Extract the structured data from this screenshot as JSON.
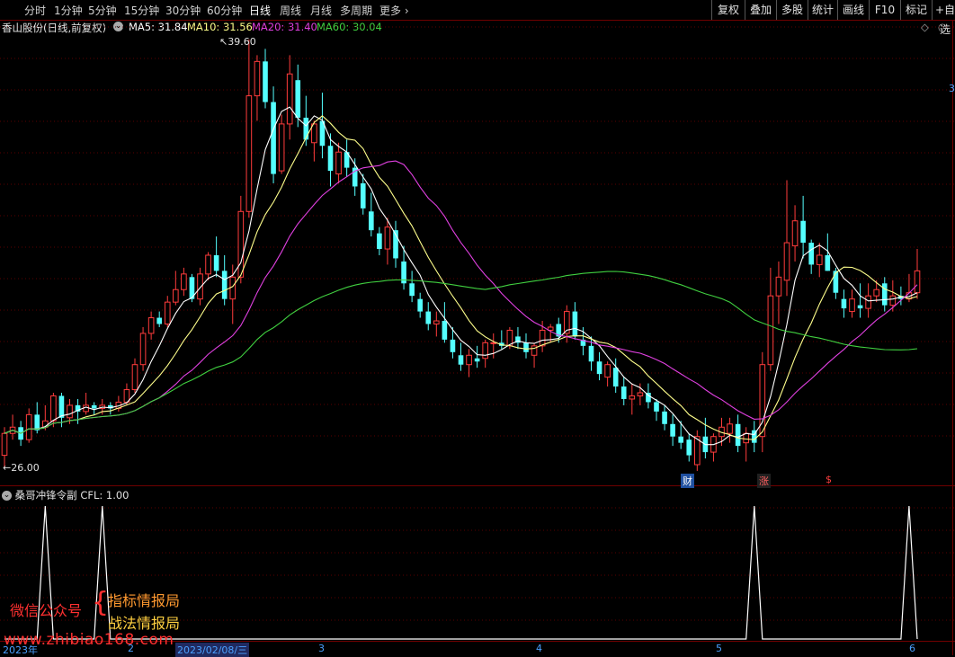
{
  "toolbar": {
    "periods": [
      "分时",
      "1分钟",
      "5分钟",
      "15分钟",
      "30分钟",
      "60分钟",
      "日线",
      "周线",
      "月线",
      "多周期",
      "更多 ›"
    ],
    "active_period": "日线",
    "right_buttons": [
      "复权",
      "叠加",
      "多股",
      "统计",
      "画线",
      "F10",
      "标记",
      "+自选"
    ]
  },
  "stock_info": {
    "title": "香山股份(日线,前复权)",
    "ma5": "MA5: 31.84",
    "ma10": "MA10: 31.56",
    "ma20": "MA20: 31.40",
    "ma60": "MA60: 30.04"
  },
  "colors": {
    "up": "#ff3c3c",
    "down": "#54ffff",
    "ma5": "#ffffff",
    "ma10": "#ffff8c",
    "ma20": "#e040e0",
    "ma60": "#40d040",
    "grid": "#5a0000",
    "axis_label": "#4aa0ff"
  },
  "price_markers": {
    "high_label": "39.60",
    "low_label": "26.00"
  },
  "right_edge_label": "3",
  "event_badges": [
    "财",
    "涨",
    "$"
  ],
  "indicator": {
    "title": "桑哥冲锋令副",
    "value": "CFL: 1.00"
  },
  "x_axis": {
    "year_label": "2023年",
    "date_cursor": "2023/02/08/三",
    "month_labels": [
      "2",
      "3",
      "4",
      "5",
      "6"
    ]
  },
  "watermark": {
    "left": "微信公众号",
    "line1": "指标情报局",
    "line2": "战法情报局",
    "url": "www.zhibiao168.com"
  },
  "chart_data": {
    "type": "candlestick",
    "ylim": [
      26.0,
      39.6
    ],
    "candles_ohlc": [
      [
        26.3,
        27.2,
        25.9,
        27.0
      ],
      [
        27.0,
        27.6,
        26.8,
        27.2
      ],
      [
        27.2,
        27.4,
        26.6,
        26.8
      ],
      [
        26.8,
        27.8,
        26.7,
        27.6
      ],
      [
        27.6,
        28.0,
        27.0,
        27.1
      ],
      [
        27.2,
        27.9,
        27.1,
        27.4
      ],
      [
        27.4,
        28.3,
        27.2,
        28.2
      ],
      [
        28.2,
        28.3,
        27.2,
        27.5
      ],
      [
        27.5,
        28.1,
        27.3,
        27.9
      ],
      [
        27.9,
        28.1,
        27.3,
        27.7
      ],
      [
        27.7,
        28.3,
        27.6,
        27.9
      ],
      [
        27.9,
        28.0,
        27.6,
        27.8
      ],
      [
        27.8,
        28.1,
        27.6,
        27.9
      ],
      [
        27.9,
        28.0,
        27.6,
        27.8
      ],
      [
        27.8,
        28.2,
        27.7,
        28.0
      ],
      [
        28.0,
        28.6,
        27.9,
        28.4
      ],
      [
        28.4,
        29.4,
        28.3,
        29.2
      ],
      [
        29.2,
        30.4,
        29.0,
        30.2
      ],
      [
        30.2,
        30.9,
        30.0,
        30.7
      ],
      [
        30.7,
        30.9,
        30.4,
        30.5
      ],
      [
        30.5,
        31.4,
        30.4,
        31.2
      ],
      [
        31.2,
        32.2,
        31.1,
        31.6
      ],
      [
        31.6,
        32.3,
        31.4,
        32.1
      ],
      [
        32.0,
        32.1,
        31.2,
        31.3
      ],
      [
        31.3,
        32.3,
        31.1,
        32.1
      ],
      [
        32.1,
        32.8,
        31.9,
        32.7
      ],
      [
        32.7,
        33.3,
        32.0,
        32.2
      ],
      [
        32.2,
        32.7,
        31.1,
        31.3
      ],
      [
        31.3,
        32.4,
        30.5,
        32.0
      ],
      [
        32.0,
        34.6,
        31.8,
        34.1
      ],
      [
        34.1,
        39.6,
        33.9,
        37.8
      ],
      [
        37.8,
        39.1,
        37.0,
        38.9
      ],
      [
        38.9,
        39.3,
        37.4,
        37.6
      ],
      [
        37.6,
        38.1,
        35.0,
        35.3
      ],
      [
        35.4,
        37.2,
        35.3,
        36.9
      ],
      [
        36.9,
        39.1,
        36.4,
        38.5
      ],
      [
        38.3,
        38.8,
        36.8,
        37.1
      ],
      [
        37.1,
        37.8,
        36.2,
        36.4
      ],
      [
        36.3,
        37.0,
        35.7,
        36.9
      ],
      [
        37.0,
        37.9,
        35.8,
        36.2
      ],
      [
        36.2,
        36.6,
        34.9,
        35.4
      ],
      [
        35.3,
        36.3,
        35.0,
        36.0
      ],
      [
        36.0,
        36.4,
        35.2,
        35.5
      ],
      [
        35.5,
        35.8,
        34.6,
        34.9
      ],
      [
        35.0,
        35.3,
        34.0,
        34.2
      ],
      [
        34.1,
        34.7,
        33.3,
        33.5
      ],
      [
        33.4,
        33.6,
        32.7,
        32.9
      ],
      [
        32.9,
        33.9,
        32.4,
        33.6
      ],
      [
        33.5,
        33.8,
        32.3,
        32.6
      ],
      [
        32.5,
        33.0,
        31.6,
        31.8
      ],
      [
        31.8,
        32.2,
        31.2,
        31.4
      ],
      [
        31.3,
        31.5,
        30.7,
        30.9
      ],
      [
        30.9,
        31.2,
        30.3,
        30.5
      ],
      [
        30.5,
        30.9,
        30.1,
        30.6
      ],
      [
        30.6,
        31.2,
        29.9,
        30.0
      ],
      [
        30.0,
        30.4,
        29.4,
        29.6
      ],
      [
        29.5,
        29.9,
        29.0,
        29.2
      ],
      [
        29.2,
        29.7,
        28.8,
        29.5
      ],
      [
        29.4,
        29.8,
        29.1,
        29.3
      ],
      [
        29.4,
        30.0,
        29.1,
        29.9
      ],
      [
        29.9,
        30.2,
        29.4,
        29.9
      ],
      [
        29.9,
        30.3,
        29.7,
        29.8
      ],
      [
        29.8,
        30.4,
        29.7,
        30.3
      ],
      [
        30.1,
        30.4,
        29.7,
        29.9
      ],
      [
        29.9,
        30.2,
        29.4,
        29.6
      ],
      [
        29.5,
        29.9,
        29.1,
        29.8
      ],
      [
        29.8,
        30.6,
        29.6,
        30.3
      ],
      [
        30.3,
        30.5,
        29.9,
        30.4
      ],
      [
        30.5,
        30.7,
        29.9,
        30.1
      ],
      [
        30.2,
        31.1,
        29.9,
        30.9
      ],
      [
        30.9,
        31.2,
        30.0,
        30.1
      ],
      [
        30.0,
        30.4,
        29.5,
        29.8
      ],
      [
        29.8,
        30.1,
        29.0,
        29.3
      ],
      [
        29.3,
        29.6,
        28.7,
        28.9
      ],
      [
        28.8,
        29.3,
        28.5,
        29.2
      ],
      [
        29.1,
        29.4,
        28.3,
        28.5
      ],
      [
        28.5,
        28.8,
        27.9,
        28.1
      ],
      [
        28.1,
        28.6,
        27.6,
        28.2
      ],
      [
        28.2,
        28.6,
        27.9,
        28.3
      ],
      [
        28.3,
        28.6,
        27.8,
        28.0
      ],
      [
        28.0,
        28.1,
        27.4,
        27.7
      ],
      [
        27.7,
        27.9,
        27.1,
        27.3
      ],
      [
        27.3,
        27.6,
        26.6,
        26.9
      ],
      [
        26.9,
        27.4,
        26.5,
        26.7
      ],
      [
        26.8,
        27.0,
        26.1,
        26.3
      ],
      [
        26.0,
        27.1,
        25.8,
        26.9
      ],
      [
        26.9,
        27.5,
        26.2,
        26.4
      ],
      [
        26.4,
        27.0,
        26.1,
        26.9
      ],
      [
        26.9,
        27.5,
        26.6,
        27.2
      ],
      [
        27.0,
        27.5,
        26.7,
        27.3
      ],
      [
        27.3,
        27.6,
        26.4,
        26.6
      ],
      [
        26.7,
        27.2,
        26.1,
        27.0
      ],
      [
        27.1,
        27.4,
        26.4,
        26.7
      ],
      [
        26.9,
        29.6,
        26.4,
        29.2
      ],
      [
        29.2,
        32.3,
        29.0,
        31.4
      ],
      [
        31.4,
        32.5,
        30.5,
        32.0
      ],
      [
        31.9,
        35.1,
        31.4,
        33.1
      ],
      [
        33.0,
        34.3,
        32.5,
        33.8
      ],
      [
        33.8,
        34.6,
        32.6,
        33.1
      ],
      [
        33.1,
        33.2,
        32.1,
        32.4
      ],
      [
        32.4,
        33.1,
        32.0,
        32.7
      ],
      [
        32.7,
        33.4,
        32.2,
        32.2
      ],
      [
        32.2,
        32.3,
        31.3,
        31.5
      ],
      [
        31.3,
        31.6,
        30.7,
        31.0
      ],
      [
        30.9,
        31.6,
        30.7,
        31.3
      ],
      [
        31.1,
        31.8,
        30.7,
        31.0
      ],
      [
        31.0,
        31.8,
        30.7,
        31.4
      ],
      [
        31.4,
        31.9,
        31.2,
        31.6
      ],
      [
        31.8,
        32.0,
        30.9,
        31.1
      ],
      [
        31.1,
        31.9,
        30.9,
        31.4
      ],
      [
        31.4,
        31.7,
        31.1,
        31.3
      ],
      [
        31.3,
        32.1,
        31.2,
        31.5
      ],
      [
        31.5,
        32.9,
        31.3,
        32.2
      ]
    ],
    "indicator_signals": [
      5,
      12,
      92,
      111
    ],
    "indicator_ylim": [
      0,
      1
    ]
  }
}
